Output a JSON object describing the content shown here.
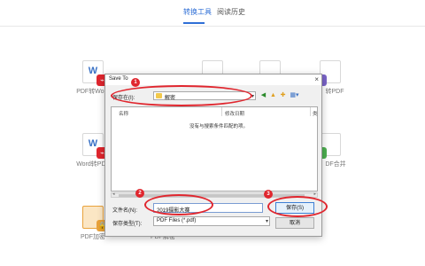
{
  "header": {
    "tabs": [
      {
        "label": "转换工具",
        "active": true
      },
      {
        "label": "阅读历史",
        "active": false
      }
    ]
  },
  "tools": [
    {
      "label": "PDF转Word",
      "glyph": "W",
      "color": "#3b72c5",
      "icon": "pdf-to-word-icon"
    },
    {
      "label": "",
      "glyph": "",
      "color": "#e9952f",
      "icon": "pdf-tool-icon"
    },
    {
      "label": "",
      "glyph": "",
      "color": "#9a62c2",
      "icon": "pdf-tool-icon"
    },
    {
      "label": "转PDF",
      "glyph": "",
      "color": "#7a64c8",
      "icon": "image-to-pdf-icon"
    },
    {
      "label": "Word转PDF",
      "glyph": "W",
      "color": "#3b72c5",
      "icon": "word-to-pdf-icon"
    },
    {
      "label": "DF合并",
      "glyph": "",
      "color": "#4caf50",
      "icon": "pdf-merge-icon"
    },
    {
      "label": "PDF加密",
      "glyph": "",
      "color": "#e9a23b",
      "icon": "pdf-encrypt-icon"
    },
    {
      "label": "PDF解密",
      "glyph": "",
      "color": "#e9952f",
      "icon": "pdf-decrypt-icon"
    }
  ],
  "dialog": {
    "title": "Save To",
    "save_in_label": "保存在(I):",
    "save_in_value": "解密",
    "columns": [
      "名称",
      "修改日期",
      "类"
    ],
    "empty_text": "没有与搜索条件匹配的项。",
    "filename_label": "文件名(N):",
    "filename_value": "2019摄影大赛",
    "filetype_label": "保存类型(T):",
    "filetype_value": "PDF Files (*.pdf)",
    "save_button": "保存(S)",
    "cancel_button": "取消"
  },
  "annotations": [
    "1",
    "2",
    "3"
  ],
  "colors": {
    "accent": "#2f6fd6",
    "annotation": "#e0262e"
  }
}
